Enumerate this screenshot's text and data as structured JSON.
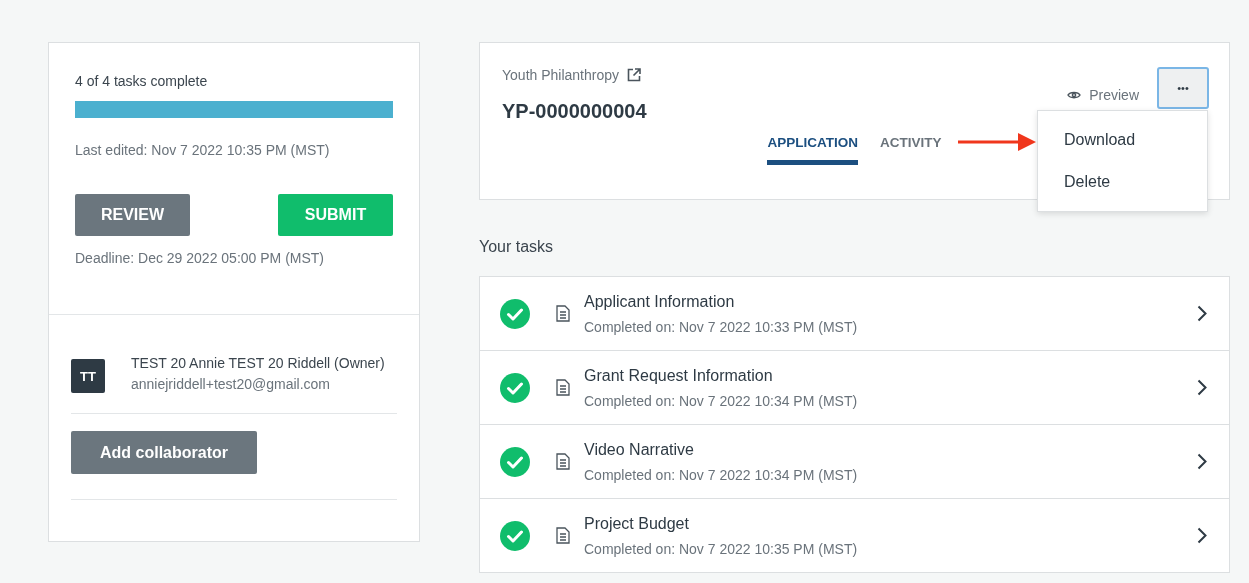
{
  "progress": {
    "label": "4 of 4 tasks complete",
    "level": 1
  },
  "last_edited": "Last edited: Nov 7 2022 10:35 PM (MST)",
  "buttons": {
    "review": "REVIEW",
    "submit": "SUBMIT"
  },
  "deadline": "Deadline: Dec 29 2022 05:00 PM (MST)",
  "collaborators": [
    {
      "initials": "TT",
      "name": "TEST 20 Annie TEST 20 Riddell (Owner)",
      "email": "anniejriddell+test20@gmail.com"
    }
  ],
  "add_collaborator": "Add collaborator",
  "header": {
    "program": "Youth Philanthropy",
    "id": "YP-0000000004",
    "preview": "Preview",
    "more": "•••"
  },
  "tabs": [
    {
      "label": "APPLICATION",
      "selected": true
    },
    {
      "label": "ACTIVITY",
      "selected": false
    }
  ],
  "menu": {
    "open": true,
    "items": [
      {
        "label": "Download",
        "pointed": true
      },
      {
        "label": "Delete",
        "pointed": false
      }
    ]
  },
  "tasks_title": "Your tasks",
  "tasks": [
    {
      "name": "Applicant Information",
      "status": "Completed on: Nov 7 2022 10:33 PM (MST)",
      "completed": true
    },
    {
      "name": "Grant Request Information",
      "status": "Completed on: Nov 7 2022 10:34 PM (MST)",
      "completed": true
    },
    {
      "name": "Video Narrative",
      "status": "Completed on: Nov 7 2022 10:34 PM (MST)",
      "completed": true
    },
    {
      "name": "Project Budget",
      "status": "Completed on: Nov 7 2022 10:35 PM (MST)",
      "completed": true
    }
  ]
}
